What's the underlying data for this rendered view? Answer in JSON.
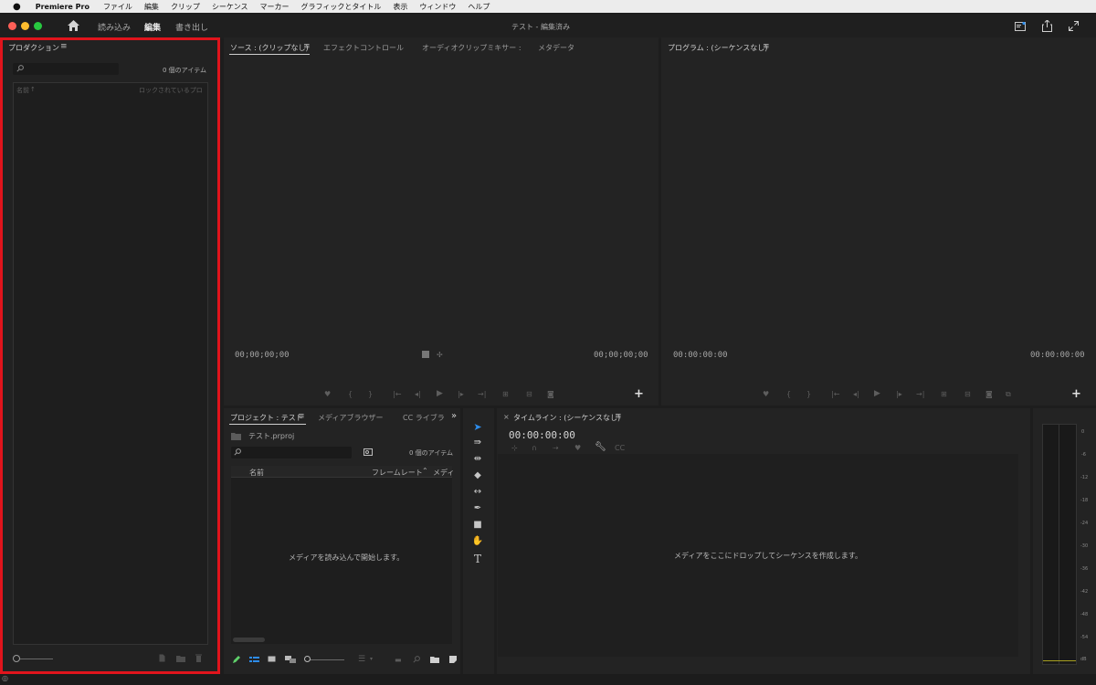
{
  "menubar": {
    "apple": "",
    "app_name": "Premiere Pro",
    "items": [
      "ファイル",
      "編集",
      "クリップ",
      "シーケンス",
      "マーカー",
      "グラフィックとタイトル",
      "表示",
      "ウィンドウ",
      "ヘルプ"
    ]
  },
  "titlebar": {
    "workspaces": [
      "読み込み",
      "編集",
      "書き出し"
    ],
    "active_workspace": "編集",
    "title": "テスト - 編集済み"
  },
  "production_panel": {
    "title": "プロダクション",
    "search_placeholder": "",
    "item_count": "0 個のアイテム",
    "col_name": "名前",
    "col_locked": "ロックされているプロ"
  },
  "source_panel": {
    "tabs": [
      "ソース : (クリップなし)",
      "エフェクトコントロール",
      "オーディオクリップミキサー :",
      "メタデータ"
    ],
    "tc_left": "00;00;00;00",
    "tc_right": "00;00;00;00"
  },
  "program_panel": {
    "title": "プログラム : (シーケンスなし)",
    "tc_left": "00:00:00:00",
    "tc_right": "00:00:00:00"
  },
  "project_panel": {
    "tabs": [
      "プロジェクト : テスト",
      "メディアブラウザー",
      "CC ライブラ"
    ],
    "file_name": "テスト.prproj",
    "item_count": "0 個のアイテム",
    "col_name": "名前",
    "col_framerate": "フレームレート",
    "col_media": "メディ",
    "empty_msg": "メディアを読み込んで開始します。"
  },
  "timeline_panel": {
    "title": "タイムライン : (シーケンスなし)",
    "tc": "00:00:00:00",
    "empty_msg": "メディアをここにドロップしてシーケンスを作成します。"
  },
  "audio_meter": {
    "scale": [
      "0",
      "-6",
      "-12",
      "-18",
      "-24",
      "-30",
      "-36",
      "-42",
      "-48",
      "-54",
      "dB"
    ]
  },
  "colors": {
    "highlight_border": "#e0141c",
    "accent_blue": "#2d8ceb"
  }
}
